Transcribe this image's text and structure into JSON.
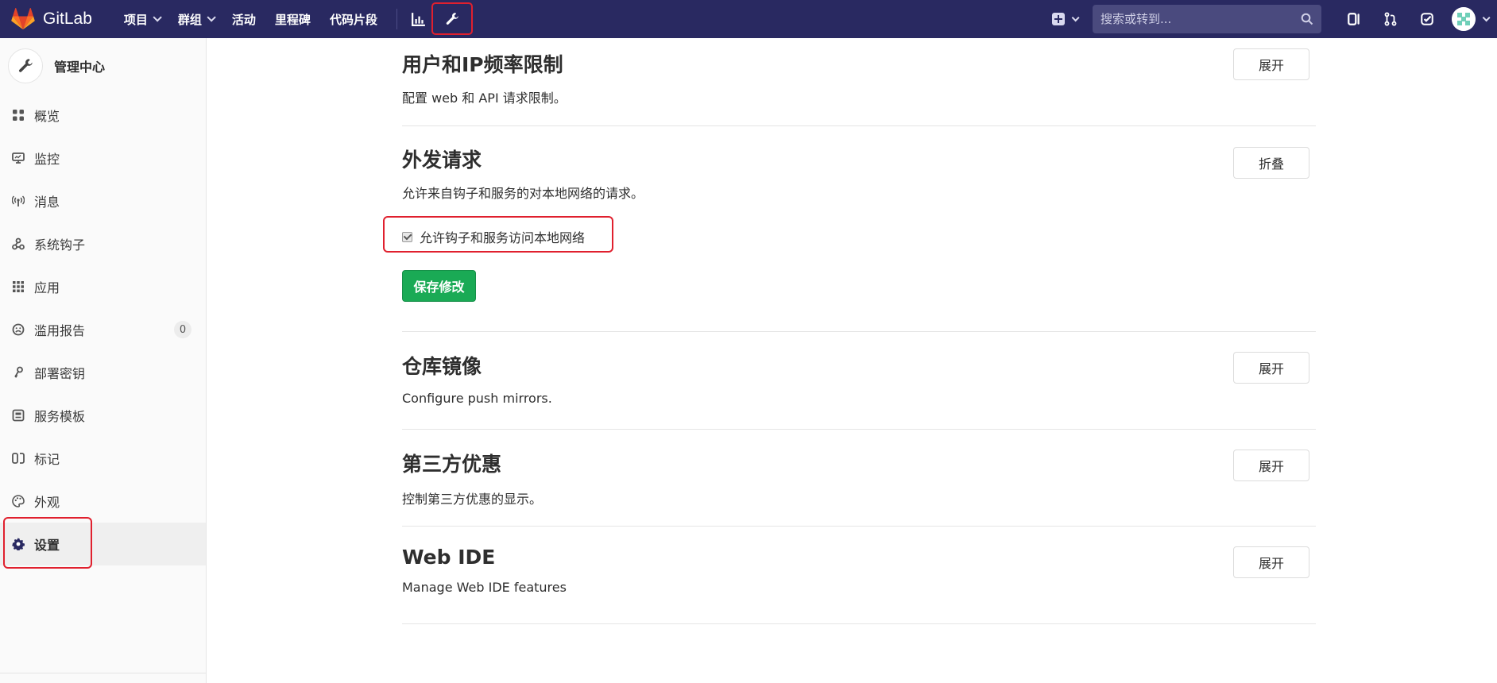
{
  "navbar": {
    "brand": "GitLab",
    "items": [
      {
        "label": "项目",
        "has_caret": true
      },
      {
        "label": "群组",
        "has_caret": true
      },
      {
        "label": "活动",
        "has_caret": false
      },
      {
        "label": "里程碑",
        "has_caret": false
      },
      {
        "label": "代码片段",
        "has_caret": false
      }
    ],
    "search_placeholder": "搜索或转到...",
    "icons": [
      "chart-icon",
      "wrench-icon",
      "plus-square-icon",
      "search-icon",
      "issues-icon",
      "merge-request-icon",
      "todo-icon",
      "avatar"
    ]
  },
  "sidebar": {
    "title": "管理中心",
    "items": [
      {
        "label": "概览",
        "icon": "overview-icon"
      },
      {
        "label": "监控",
        "icon": "monitor-icon"
      },
      {
        "label": "消息",
        "icon": "broadcast-icon"
      },
      {
        "label": "系统钩子",
        "icon": "hook-icon"
      },
      {
        "label": "应用",
        "icon": "apps-icon"
      },
      {
        "label": "滥用报告",
        "icon": "abuse-icon",
        "badge": "0"
      },
      {
        "label": "部署密钥",
        "icon": "key-icon"
      },
      {
        "label": "服务模板",
        "icon": "template-icon"
      },
      {
        "label": "标记",
        "icon": "labels-icon"
      },
      {
        "label": "外观",
        "icon": "palette-icon"
      },
      {
        "label": "设置",
        "icon": "settings-icon",
        "active": true
      }
    ]
  },
  "sections": {
    "rate_limits": {
      "title": "用户和IP频率限制",
      "desc": "配置 web 和 API 请求限制。",
      "button": "展开"
    },
    "outbound": {
      "title": "外发请求",
      "desc": "允许来自钩子和服务的对本地网络的请求。",
      "button": "折叠",
      "checkbox_label": "允许钩子和服务访问本地网络",
      "checkbox_checked": true,
      "save_button": "保存修改"
    },
    "mirrors": {
      "title": "仓库镜像",
      "desc": "Configure push mirrors.",
      "button": "展开"
    },
    "third_party": {
      "title": "第三方优惠",
      "desc": "控制第三方优惠的显示。",
      "button": "展开"
    },
    "web_ide": {
      "title": "Web IDE",
      "desc": "Manage Web IDE features",
      "button": "展开"
    }
  },
  "colors": {
    "navbar": "#292961",
    "save_button": "#1aaa55",
    "highlight": "#e0202e"
  }
}
